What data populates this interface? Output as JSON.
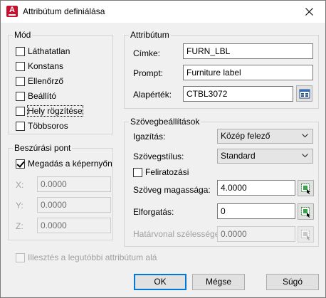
{
  "window": {
    "title": "Attribútum definiálása",
    "close_icon": "close-icon",
    "app_icon": "autocad-logo"
  },
  "mode": {
    "title": "Mód",
    "options": [
      {
        "label": "Láthatatlan",
        "checked": false
      },
      {
        "label": "Konstans",
        "checked": false
      },
      {
        "label": "Ellenőrző",
        "checked": false
      },
      {
        "label": "Beállító",
        "checked": false
      },
      {
        "label": "Hely rögzítése",
        "checked": false,
        "focused": true
      },
      {
        "label": "Többsoros",
        "checked": false
      }
    ]
  },
  "insertion": {
    "title": "Beszúrási pont",
    "specify_on_screen": {
      "label": "Megadás a képernyőn",
      "checked": true
    },
    "x": {
      "label": "X:",
      "value": "0.0000"
    },
    "y": {
      "label": "Y:",
      "value": "0.0000"
    },
    "z": {
      "label": "Z:",
      "value": "0.0000"
    }
  },
  "align_below": {
    "label": "Illesztés a legutóbbi attribútum alá",
    "checked": false
  },
  "attribute": {
    "title": "Attribútum",
    "tag": {
      "label": "Címke:",
      "value": "FURN_LBL"
    },
    "prompt": {
      "label": "Prompt:",
      "value": "Furniture label"
    },
    "default": {
      "label": "Alapérték:",
      "value": "CTBL3072"
    }
  },
  "text_settings": {
    "title": "Szövegbeállítások",
    "justification": {
      "label": "Igazítás:",
      "value": "Közép felező"
    },
    "text_style": {
      "label": "Szövegstílus:",
      "value": "Standard"
    },
    "annotative": {
      "label": "Feliratozási",
      "checked": false
    },
    "text_height": {
      "label": "Szöveg magassága:",
      "value": "4.0000"
    },
    "rotation": {
      "label": "Elforgatás:",
      "value": "0"
    },
    "boundary_width": {
      "label": "Határvonal szélessége:",
      "value": "0.0000"
    }
  },
  "buttons": {
    "ok": "OK",
    "cancel": "Mégse",
    "help": "Súgó"
  },
  "colors": {
    "accent": "#0078d7",
    "app_red": "#c8102e"
  }
}
